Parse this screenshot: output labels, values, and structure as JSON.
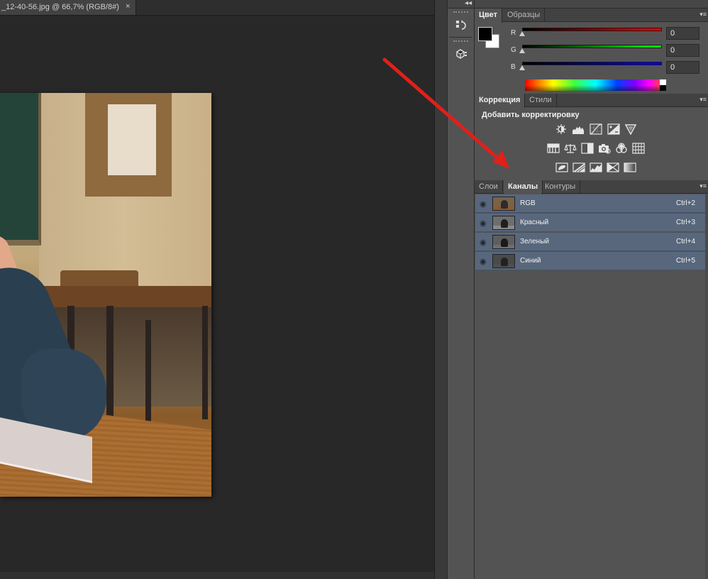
{
  "document": {
    "tab_title": "_12-40-56.jpg @ 66,7% (RGB/8#)",
    "close_glyph": "×"
  },
  "dock": {
    "collapse_glyph": "◂◂"
  },
  "color_panel": {
    "tabs": [
      "Цвет",
      "Образцы"
    ],
    "channels": [
      {
        "label": "R",
        "value": "0",
        "color_from": "#000000",
        "color_to": "#ff0000"
      },
      {
        "label": "G",
        "value": "0",
        "color_from": "#000000",
        "color_to": "#00ff00"
      },
      {
        "label": "B",
        "value": "0",
        "color_from": "#000000",
        "color_to": "#0000ff"
      }
    ]
  },
  "adjustments_panel": {
    "tabs": [
      "Коррекция",
      "Стили"
    ],
    "title": "Добавить корректировку",
    "icons_row1": [
      "brightness-contrast-icon",
      "levels-icon",
      "curves-icon",
      "exposure-icon",
      "vibrance-icon"
    ],
    "icons_row2": [
      "hue-saturation-icon",
      "color-balance-icon",
      "black-white-icon",
      "photo-filter-icon",
      "channel-mixer-icon",
      "color-lookup-icon"
    ],
    "icons_row3": [
      "invert-icon",
      "posterize-icon",
      "threshold-icon",
      "selective-color-icon",
      "gradient-map-icon"
    ]
  },
  "layers_panel": {
    "tabs": [
      "Слои",
      "Каналы",
      "Контуры"
    ],
    "active_tab": "Каналы",
    "channels": [
      {
        "name": "RGB",
        "shortcut": "Ctrl+2"
      },
      {
        "name": "Красный",
        "shortcut": "Ctrl+3"
      },
      {
        "name": "Зеленый",
        "shortcut": "Ctrl+4"
      },
      {
        "name": "Синий",
        "shortcut": "Ctrl+5"
      }
    ]
  },
  "colors": {
    "selected_row": "#58677c",
    "panel_bg": "#535353",
    "arrow": "#e0201a"
  }
}
